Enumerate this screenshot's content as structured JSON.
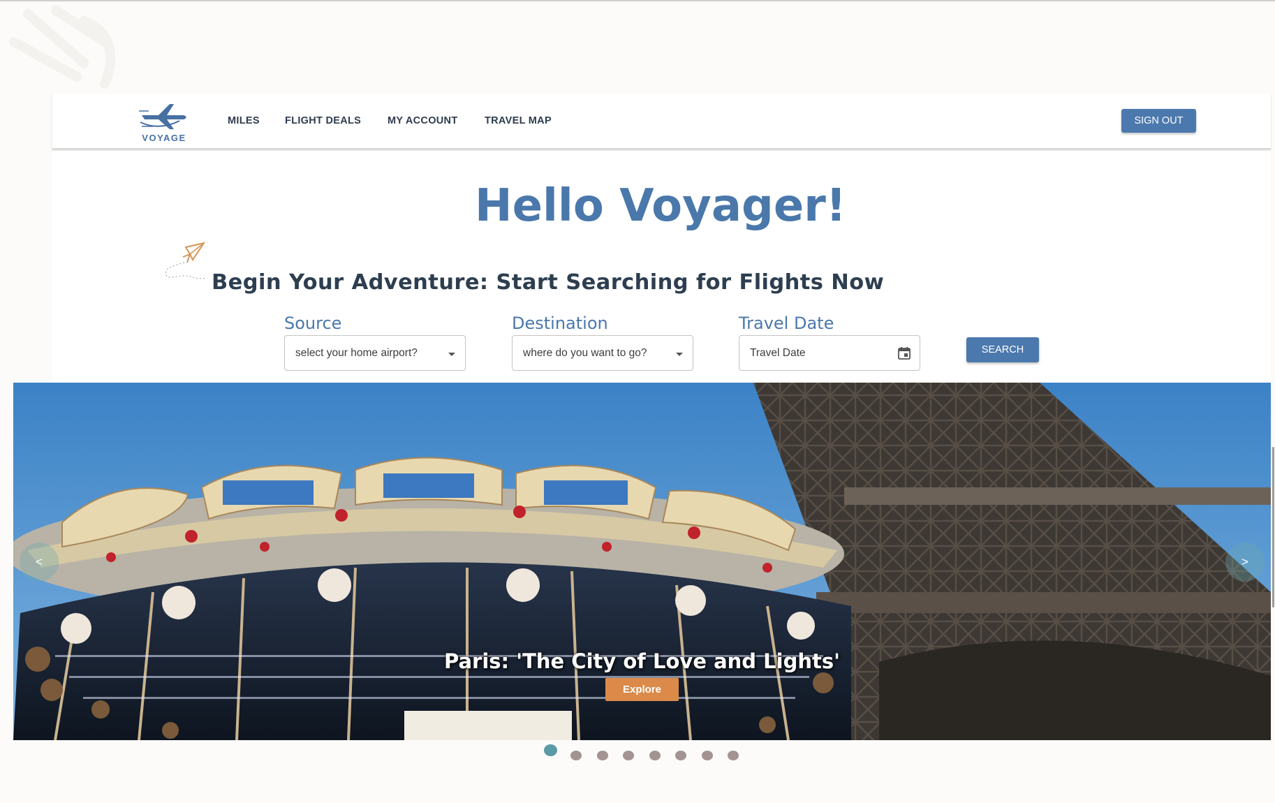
{
  "brand": {
    "name": "VOYAGE"
  },
  "nav": {
    "links": [
      "MILES",
      "FLIGHT DEALS",
      "MY ACCOUNT",
      "TRAVEL MAP"
    ],
    "signout_label": "SIGN OUT"
  },
  "hero": {
    "greeting": "Hello Voyager!",
    "headline": "Begin Your Adventure: Start Searching for Flights Now"
  },
  "search": {
    "source": {
      "label": "Source",
      "placeholder": "select your home airport?"
    },
    "destination": {
      "label": "Destination",
      "placeholder": "where do you want to go?"
    },
    "date": {
      "label": "Travel Date",
      "placeholder": "Travel Date"
    },
    "button_label": "SEARCH"
  },
  "carousel": {
    "caption": "Paris: 'The City of Love and Lights'",
    "button_label": "Explore",
    "prev_label": "<",
    "next_label": ">",
    "active_index": 0,
    "slide_count": 8
  },
  "colors": {
    "primary": "#4c79ad",
    "heading": "#4a78ab",
    "dark_text": "#2d3e50",
    "explore": "#db8a49",
    "dot_active": "#5b9aa6",
    "dot_inactive": "#a49393"
  },
  "icons": {
    "logo": "airplane-logo-icon",
    "doodle": "paper-plane-icon",
    "calendar": "calendar-icon",
    "dropdown": "chevron-down-icon"
  }
}
